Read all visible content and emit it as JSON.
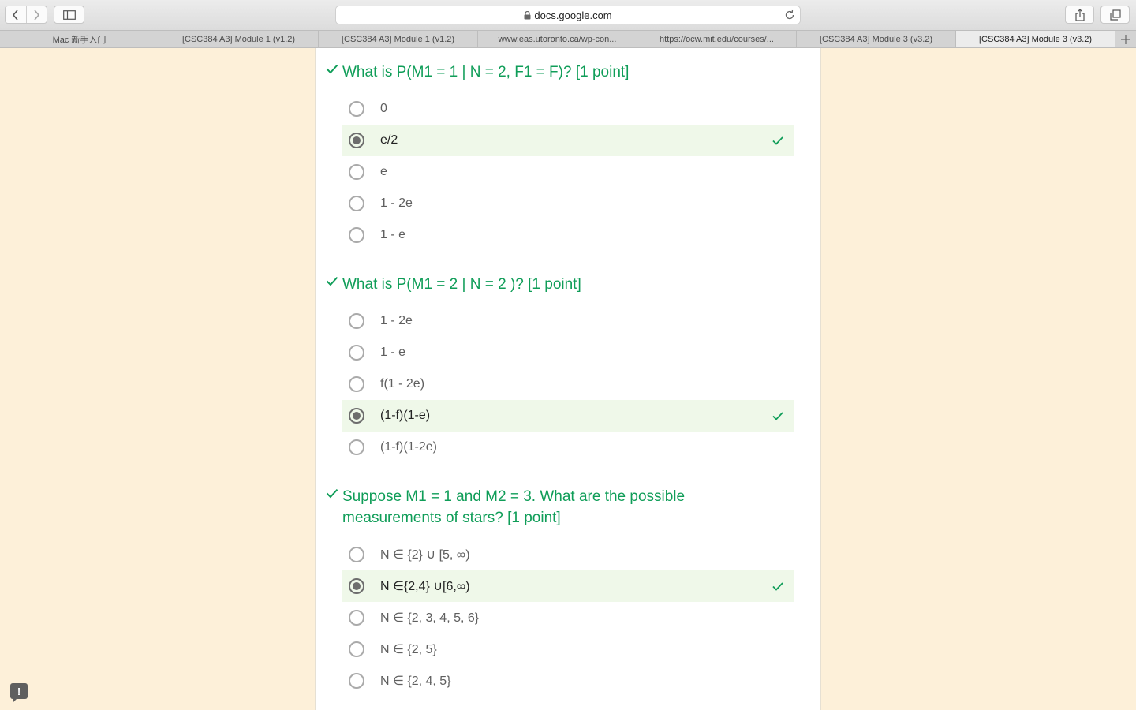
{
  "browser": {
    "url": "docs.google.com",
    "tabs": [
      {
        "label": "Mac 新手入门",
        "active": false
      },
      {
        "label": "[CSC384 A3] Module 1 (v1.2)",
        "active": false
      },
      {
        "label": "[CSC384 A3] Module 1 (v1.2)",
        "active": false
      },
      {
        "label": "www.eas.utoronto.ca/wp-con...",
        "active": false
      },
      {
        "label": "https://ocw.mit.edu/courses/...",
        "active": false
      },
      {
        "label": "[CSC384 A3] Module 3 (v3.2)",
        "active": false
      },
      {
        "label": "[CSC384 A3] Module 3 (v3.2)",
        "active": true
      }
    ]
  },
  "colors": {
    "correct_green": "#0f9d58",
    "selected_bg": "#eff8e9",
    "page_bg": "#fdf0d9"
  },
  "questions": [
    {
      "title": "What is P(M1 = 1 | N = 2, F1 = F)? [1 point]",
      "options": [
        {
          "label": "0",
          "selected": false
        },
        {
          "label": "e/2",
          "selected": true
        },
        {
          "label": "e",
          "selected": false
        },
        {
          "label": "1 - 2e",
          "selected": false
        },
        {
          "label": "1 - e",
          "selected": false
        }
      ]
    },
    {
      "title": "What is P(M1 = 2 | N = 2 )? [1 point]",
      "options": [
        {
          "label": "1 - 2e",
          "selected": false
        },
        {
          "label": "1 - e",
          "selected": false
        },
        {
          "label": "f(1 - 2e)",
          "selected": false
        },
        {
          "label": "(1-f)(1-e)",
          "selected": true
        },
        {
          "label": "(1-f)(1-2e)",
          "selected": false
        }
      ]
    },
    {
      "title": "Suppose M1 = 1 and M2 = 3. What are the possible measurements of stars? [1 point]",
      "options": [
        {
          "label": "N ∈ {2} ∪ [5, ∞)",
          "selected": false
        },
        {
          "label": "N ∈{2,4} ∪[6,∞)",
          "selected": true
        },
        {
          "label": "N ∈ {2, 3, 4, 5, 6}",
          "selected": false
        },
        {
          "label": "N ∈ {2, 5}",
          "selected": false
        },
        {
          "label": "N ∈ {2, 4, 5}",
          "selected": false
        }
      ]
    }
  ],
  "feedback": {
    "label": "!"
  }
}
